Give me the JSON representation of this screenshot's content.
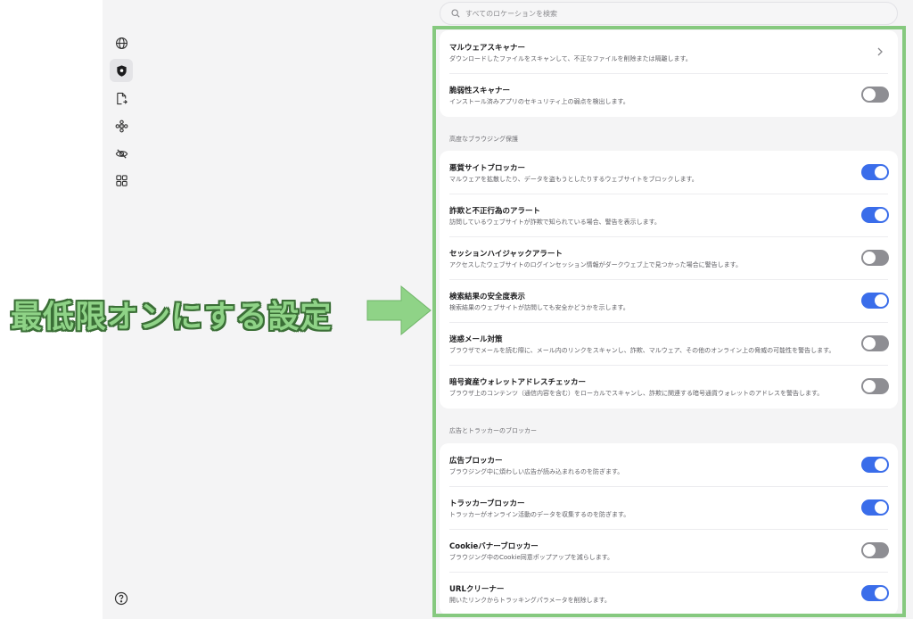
{
  "search": {
    "placeholder": "すべてのロケーションを検索"
  },
  "sidebar": {
    "items": [
      {
        "icon": "globe-icon",
        "active": false
      },
      {
        "icon": "shield-icon",
        "active": true
      },
      {
        "icon": "file-export-icon",
        "active": false
      },
      {
        "icon": "extensions-icon",
        "active": false
      },
      {
        "icon": "privacy-eye-icon",
        "active": false
      },
      {
        "icon": "apps-grid-icon",
        "active": false
      }
    ],
    "help_icon": "help-icon"
  },
  "scanners": {
    "malware": {
      "title": "マルウェアスキャナー",
      "desc": "ダウンロードしたファイルをスキャンして、不正なファイルを削除または隔離します。"
    },
    "vuln": {
      "title": "脆弱性スキャナー",
      "desc": "インストール済みアプリのセキュリティ上の弱点を検出します。",
      "enabled": false
    }
  },
  "browsing": {
    "header": "高度なブラウジング保護",
    "items": [
      {
        "title": "悪質サイトブロッカー",
        "desc": "マルウェアを拡散したり、データを盗もうとしたりするウェブサイトをブロックします。",
        "enabled": true
      },
      {
        "title": "詐欺と不正行為のアラート",
        "desc": "訪問しているウェブサイトが詐欺で知られている場合、警告を表示します。",
        "enabled": true
      },
      {
        "title": "セッションハイジャックアラート",
        "desc": "アクセスしたウェブサイトのログインセッション情報がダークウェブ上で見つかった場合に警告します。",
        "enabled": false
      },
      {
        "title": "検索結果の安全度表示",
        "desc": "検索結果のウェブサイトが訪問しても安全かどうかを示します。",
        "enabled": true
      },
      {
        "title": "迷惑メール対策",
        "desc": "ブラウザでメールを読む際に、メール内のリンクをスキャンし、詐欺、マルウェア、その他のオンライン上の脅威の可能性を警告します。",
        "enabled": false
      },
      {
        "title": "暗号資産ウォレットアドレスチェッカー",
        "desc": "ブラウザ上のコンテンツ（通信内容を含む）をローカルでスキャンし、詐欺に関連する暗号通貨ウォレットのアドレスを警告します。",
        "enabled": false
      }
    ]
  },
  "ads": {
    "header": "広告とトラッカーのブロッカー",
    "items": [
      {
        "title": "広告ブロッカー",
        "desc": "ブラウジング中に煩わしい広告が読み込まれるのを防ぎます。",
        "enabled": true
      },
      {
        "title": "トラッカーブロッカー",
        "desc": "トラッカーがオンライン活動のデータを収集するのを防ぎます。",
        "enabled": true
      },
      {
        "title": "Cookieバナーブロッカー",
        "desc": "ブラウジング中のCookie同意ポップアップを減らします。",
        "enabled": false
      },
      {
        "title": "URLクリーナー",
        "desc": "開いたリンクからトラッキングパラメータを削除します。",
        "enabled": true
      }
    ]
  },
  "annotation": {
    "text": "最低限オンにする設定",
    "color": "#8fd387"
  },
  "colors": {
    "toggle_on": "#3a6dea",
    "toggle_off": "#8e8e93",
    "frame": "#86c97f"
  }
}
